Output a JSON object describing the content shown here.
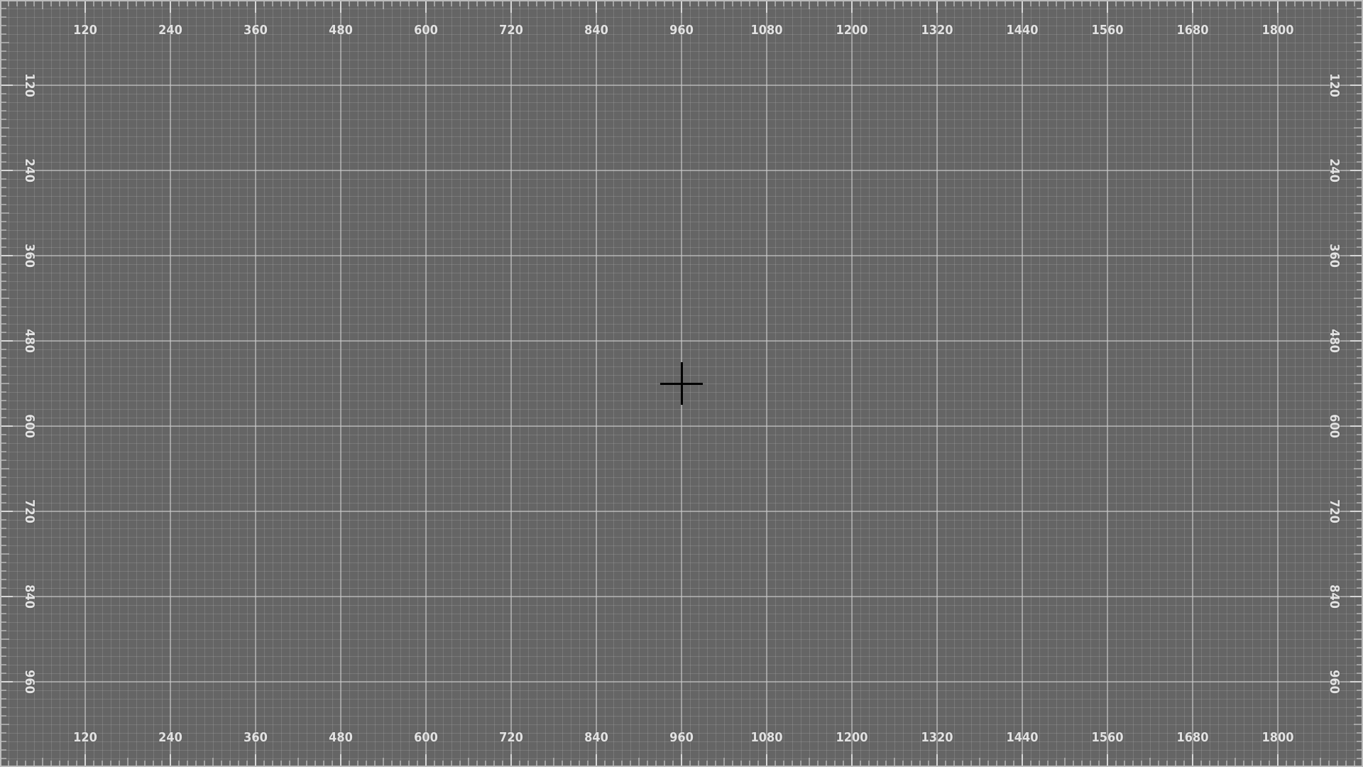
{
  "screen": {
    "background_color": "#656565",
    "major_grid_color": "#cdcdcd",
    "minor_grid_color": "#bebebe",
    "label_color": "#e2e2e2",
    "cursor_icon": "crosshair-icon"
  },
  "rulers": {
    "horizontal_labels": [
      "120",
      "240",
      "360",
      "480",
      "600",
      "720",
      "840",
      "960",
      "1080",
      "1200",
      "1320",
      "1440",
      "1560",
      "1680",
      "1800"
    ],
    "vertical_labels": [
      "120",
      "240",
      "360",
      "480",
      "600",
      "720",
      "840",
      "960"
    ]
  }
}
